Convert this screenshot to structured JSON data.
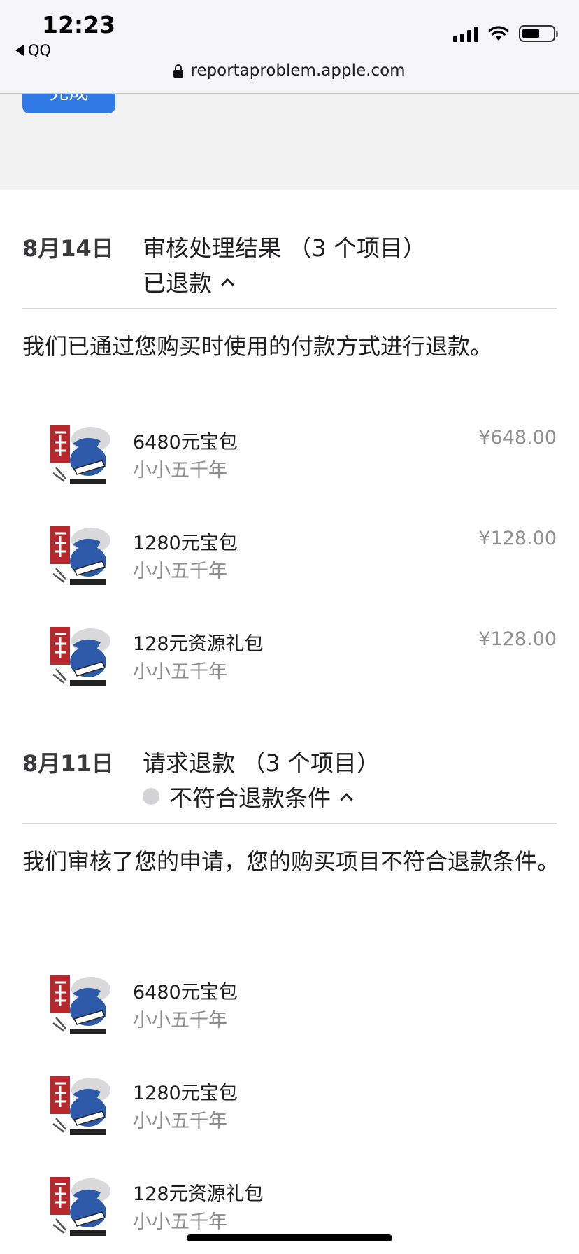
{
  "status_bar": {
    "time": "12:23",
    "back_app": "QQ",
    "signal_icon": "cellular-signal-icon",
    "wifi_icon": "wifi-icon",
    "battery_icon": "battery-icon",
    "battery_level": 0.58
  },
  "browser": {
    "url": "reportaproblem.apple.com",
    "lock_icon": "lock-icon"
  },
  "header": {
    "done_label": "完成"
  },
  "sections": [
    {
      "date": "8月14日",
      "title": "审核处理结果 （3 个项目）",
      "status": "已退款",
      "description": "我们已通过您购买时使用的付款方式进行退款。",
      "items": [
        {
          "name": "6480元宝包",
          "app": "小小五千年",
          "price": "¥648.00"
        },
        {
          "name": "1280元宝包",
          "app": "小小五千年",
          "price": "¥128.00"
        },
        {
          "name": "128元资源礼包",
          "app": "小小五千年",
          "price": "¥128.00"
        }
      ]
    },
    {
      "date": "8月11日",
      "title": "请求退款 （3 个项目）",
      "status": "不符合退款条件",
      "description": "我们审核了您的申请，您的购买项目不符合退款条件。",
      "items": [
        {
          "name": "6480元宝包",
          "app": "小小五千年"
        },
        {
          "name": "1280元宝包",
          "app": "小小五千年"
        },
        {
          "name": "128元资源礼包",
          "app": "小小五千年"
        }
      ]
    }
  ],
  "colors": {
    "accent": "#2f7ae5",
    "secondary_text": "#8e8e93",
    "app_icon_red": "#b7282e",
    "app_icon_blue": "#2c5aa8"
  }
}
